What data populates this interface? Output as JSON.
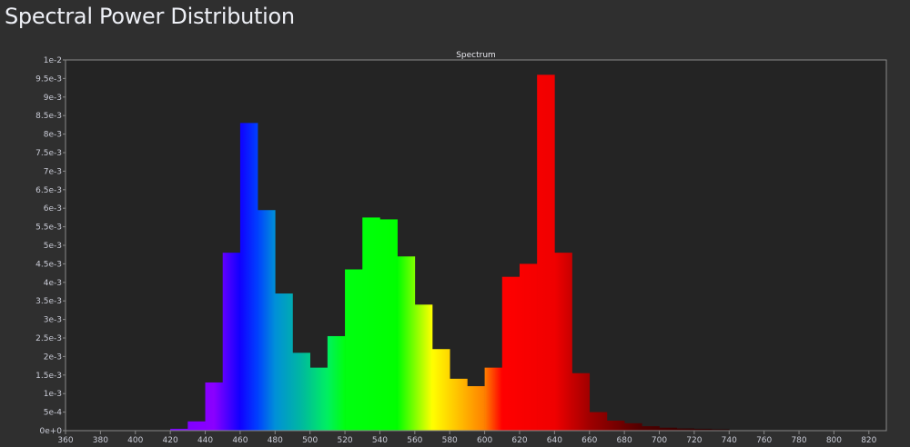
{
  "page": {
    "title": "Spectral Power Distribution"
  },
  "chart_data": {
    "type": "bar",
    "title": "Spectrum",
    "xlabel": "",
    "ylabel": "",
    "xlim": [
      360,
      830
    ],
    "ylim": [
      0,
      0.01
    ],
    "bin_width": 10,
    "x_ticks": [
      360,
      380,
      400,
      420,
      440,
      460,
      480,
      500,
      520,
      540,
      560,
      580,
      600,
      620,
      640,
      660,
      680,
      700,
      720,
      740,
      760,
      780,
      800,
      820
    ],
    "y_ticks": [
      {
        "value": 0,
        "label": "0e+0"
      },
      {
        "value": 0.0005,
        "label": "5e-4"
      },
      {
        "value": 0.001,
        "label": "1e-3"
      },
      {
        "value": 0.0015,
        "label": "1.5e-3"
      },
      {
        "value": 0.002,
        "label": "2e-3"
      },
      {
        "value": 0.0025,
        "label": "2.5e-3"
      },
      {
        "value": 0.003,
        "label": "3e-3"
      },
      {
        "value": 0.0035,
        "label": "3.5e-3"
      },
      {
        "value": 0.004,
        "label": "4e-3"
      },
      {
        "value": 0.0045,
        "label": "4.5e-3"
      },
      {
        "value": 0.005,
        "label": "5e-3"
      },
      {
        "value": 0.0055,
        "label": "5.5e-3"
      },
      {
        "value": 0.006,
        "label": "6e-3"
      },
      {
        "value": 0.0065,
        "label": "6.5e-3"
      },
      {
        "value": 0.007,
        "label": "7e-3"
      },
      {
        "value": 0.0075,
        "label": "7.5e-3"
      },
      {
        "value": 0.008,
        "label": "8e-3"
      },
      {
        "value": 0.0085,
        "label": "8.5e-3"
      },
      {
        "value": 0.009,
        "label": "9e-3"
      },
      {
        "value": 0.0095,
        "label": "9.5e-3"
      },
      {
        "value": 0.01,
        "label": "1e-2"
      }
    ],
    "bins_start": [
      420,
      430,
      440,
      450,
      460,
      470,
      480,
      490,
      500,
      510,
      520,
      530,
      540,
      550,
      560,
      570,
      580,
      590,
      600,
      610,
      620,
      630,
      640,
      650,
      660,
      670,
      680,
      690,
      700,
      710,
      720,
      730
    ],
    "values": [
      5e-05,
      0.00025,
      0.0013,
      0.0048,
      0.0083,
      0.00595,
      0.0037,
      0.0021,
      0.0017,
      0.00255,
      0.00435,
      0.00575,
      0.0057,
      0.0047,
      0.0034,
      0.0022,
      0.0014,
      0.0012,
      0.0017,
      0.00415,
      0.0045,
      0.0096,
      0.0048,
      0.00155,
      0.0005,
      0.00027,
      0.0002,
      0.00012,
      8e-05,
      6e-05,
      5e-05,
      4e-05
    ],
    "grid": false,
    "color_stops": [
      {
        "nm": 420,
        "color": "#7a00ff"
      },
      {
        "nm": 445,
        "color": "#8a00ff"
      },
      {
        "nm": 460,
        "color": "#1000ff"
      },
      {
        "nm": 470,
        "color": "#0040ff"
      },
      {
        "nm": 480,
        "color": "#0090d8"
      },
      {
        "nm": 495,
        "color": "#00b8a0"
      },
      {
        "nm": 510,
        "color": "#00f060"
      },
      {
        "nm": 520,
        "color": "#00ff10"
      },
      {
        "nm": 550,
        "color": "#00ff00"
      },
      {
        "nm": 570,
        "color": "#ffff00"
      },
      {
        "nm": 585,
        "color": "#ffc000"
      },
      {
        "nm": 600,
        "color": "#ff8000"
      },
      {
        "nm": 610,
        "color": "#ff0000"
      },
      {
        "nm": 640,
        "color": "#f00000"
      },
      {
        "nm": 660,
        "color": "#a00000"
      },
      {
        "nm": 690,
        "color": "#500000"
      },
      {
        "nm": 740,
        "color": "#1a0000"
      }
    ],
    "colors": {
      "plot_bg": "#242424",
      "axis": "#8a8a8a",
      "page_bg": "#2f2f2f"
    }
  }
}
